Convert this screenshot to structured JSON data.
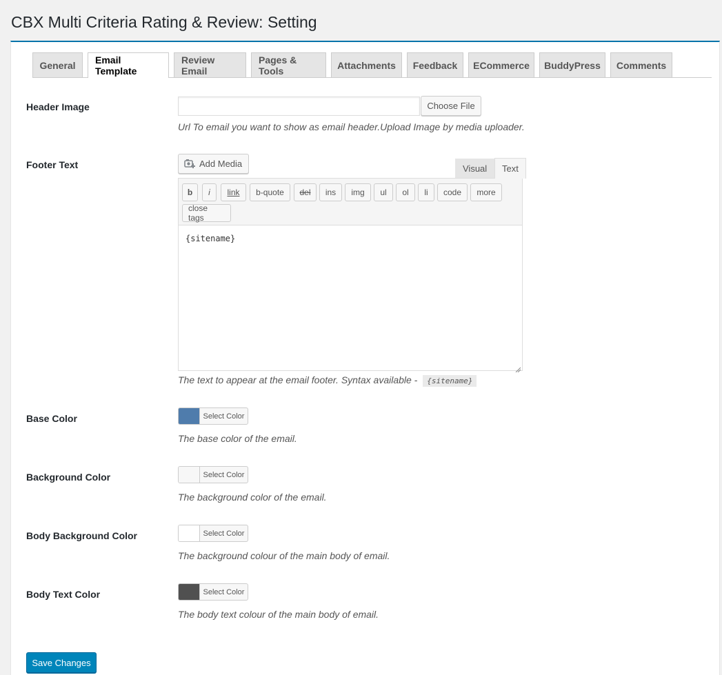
{
  "page": {
    "title": "CBX Multi Criteria Rating & Review: Setting"
  },
  "tabs": [
    {
      "label": "General",
      "active": false
    },
    {
      "label": "Email Template",
      "active": true
    },
    {
      "label": "Review Email",
      "active": false
    },
    {
      "label": "Pages & Tools",
      "active": false
    },
    {
      "label": "Attachments",
      "active": false
    },
    {
      "label": "Feedback",
      "active": false
    },
    {
      "label": "ECommerce",
      "active": false
    },
    {
      "label": "BuddyPress",
      "active": false
    },
    {
      "label": "Comments",
      "active": false
    }
  ],
  "header_image": {
    "label": "Header Image",
    "value": "",
    "choose_button": "Choose File",
    "description": "Url To email you want to show as email header.Upload Image by media uploader."
  },
  "footer_text": {
    "label": "Footer Text",
    "add_media": "Add Media",
    "tab_visual": "Visual",
    "tab_text": "Text",
    "toolbar": [
      "b",
      "i",
      "link",
      "b-quote",
      "del",
      "ins",
      "img",
      "ul",
      "ol",
      "li",
      "code",
      "more",
      "close tags"
    ],
    "content": "{sitename}",
    "description": "The text to appear at the email footer. Syntax available -",
    "syntax": "{sitename}"
  },
  "colors": [
    {
      "label": "Base Color",
      "swatch": "#4f7cac",
      "button": "Select Color",
      "description": "The base color of the email."
    },
    {
      "label": "Background Color",
      "swatch": "#f7f7f7",
      "button": "Select Color",
      "description": "The background color of the email."
    },
    {
      "label": "Body Background Color",
      "swatch": "#ffffff",
      "button": "Select Color",
      "description": "The background colour of the main body of email."
    },
    {
      "label": "Body Text Color",
      "swatch": "#505050",
      "button": "Select Color",
      "description": "The body text colour of the main body of email."
    }
  ],
  "save_button": "Save Changes"
}
